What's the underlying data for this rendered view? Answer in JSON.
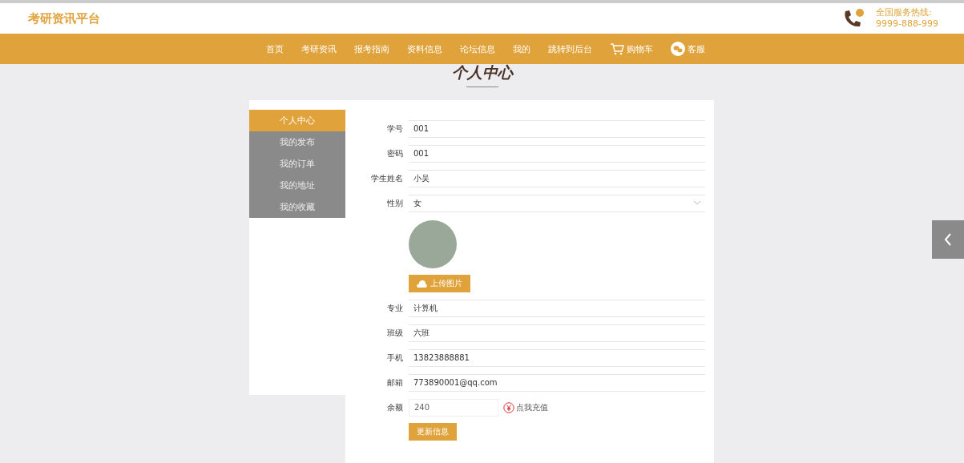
{
  "site": {
    "title": "考研资讯平台",
    "hotline_label": "全国服务热线:",
    "hotline_number": "9999-888-999"
  },
  "nav": [
    {
      "label": "首页",
      "kind": "link"
    },
    {
      "label": "考研资讯",
      "kind": "link"
    },
    {
      "label": "报考指南",
      "kind": "link"
    },
    {
      "label": "资料信息",
      "kind": "link"
    },
    {
      "label": "论坛信息",
      "kind": "link"
    },
    {
      "label": "我的",
      "kind": "link"
    },
    {
      "label": "跳转到后台",
      "kind": "link"
    },
    {
      "label": "购物车",
      "kind": "cart"
    },
    {
      "label": "客服",
      "kind": "service"
    }
  ],
  "page_title": "个人中心",
  "sidebar": [
    {
      "label": "个人中心",
      "selected": true
    },
    {
      "label": "我的发布",
      "selected": false
    },
    {
      "label": "我的订单",
      "selected": false
    },
    {
      "label": "我的地址",
      "selected": false
    },
    {
      "label": "我的收藏",
      "selected": false
    }
  ],
  "form": {
    "fields": [
      {
        "kind": "text",
        "label": "学号",
        "value": "001"
      },
      {
        "kind": "text",
        "label": "密码",
        "value": "001"
      },
      {
        "kind": "text",
        "label": "学生姓名",
        "value": "小吴"
      },
      {
        "kind": "select",
        "label": "性别",
        "value": "女"
      },
      {
        "kind": "avatar",
        "button": "上传图片"
      },
      {
        "kind": "text",
        "label": "专业",
        "value": "计算机"
      },
      {
        "kind": "text",
        "label": "班级",
        "value": "六班"
      },
      {
        "kind": "text",
        "label": "手机",
        "value": "13823888881"
      },
      {
        "kind": "text",
        "label": "邮箱",
        "value": "773890001@qq.com"
      },
      {
        "kind": "balance",
        "label": "余额",
        "value": "240",
        "link": "点我充值"
      }
    ],
    "submit": "更新信息"
  }
}
